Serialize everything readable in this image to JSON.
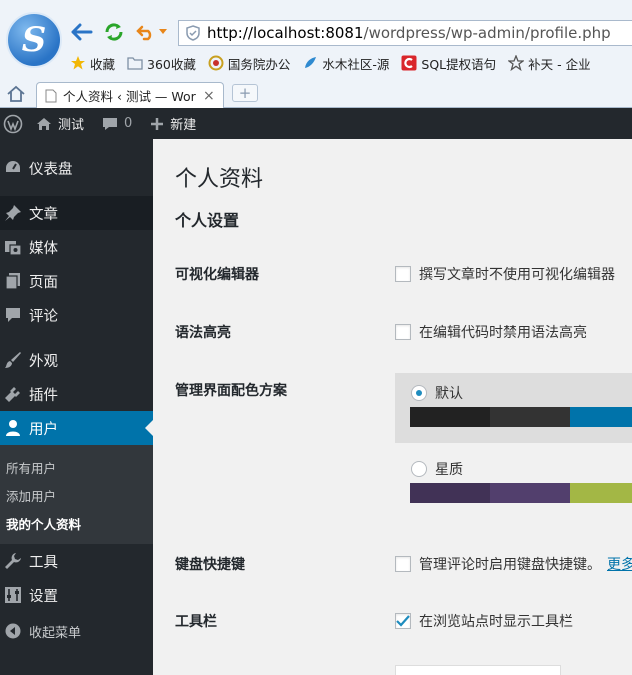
{
  "browser": {
    "url_host": "http://localhost:8081",
    "url_path": "/wordpress/wp-admin/profile.php",
    "bookmarks": [
      {
        "label": "收藏",
        "icon": "star-icon",
        "color": "#f2b705"
      },
      {
        "label": "360收藏",
        "icon": "folder-icon",
        "color": "#7d8fa3"
      },
      {
        "label": "国务院办公",
        "icon": "gov-icon",
        "color": "#c8a020"
      },
      {
        "label": "水木社区-源",
        "icon": "leaf-icon",
        "color": "#2f8ad0"
      },
      {
        "label": "SQL提权语句",
        "icon": "c-icon",
        "color": "#d9262b"
      },
      {
        "label": "补天 - 企业",
        "icon": "butian-icon",
        "color": "#555555"
      }
    ],
    "tab": {
      "label": "个人资料 ‹ 测试 — Wor",
      "close": "×"
    },
    "new_tab": "+"
  },
  "adminbar": {
    "site_name": "测试",
    "comments_count": "0",
    "new_label": "新建"
  },
  "sidebar": {
    "items": [
      {
        "label": "仪表盘",
        "icon": "dashboard-icon"
      },
      {
        "label": "文章",
        "icon": "pushpin-icon"
      },
      {
        "label": "媒体",
        "icon": "media-icon"
      },
      {
        "label": "页面",
        "icon": "page-icon"
      },
      {
        "label": "评论",
        "icon": "comment-icon"
      },
      {
        "label": "外观",
        "icon": "brush-icon"
      },
      {
        "label": "插件",
        "icon": "plugin-icon"
      },
      {
        "label": "用户",
        "icon": "user-icon"
      },
      {
        "label": "工具",
        "icon": "wrench-icon"
      },
      {
        "label": "设置",
        "icon": "settings-icon"
      }
    ],
    "submenu": [
      "所有用户",
      "添加用户",
      "我的个人资料"
    ],
    "collapse_label": "收起菜单"
  },
  "main": {
    "page_title": "个人资料",
    "section_title": "个人设置",
    "visual_editor": {
      "label": "可视化编辑器",
      "option": "撰写文章时不使用可视化编辑器",
      "checked": false
    },
    "syntax": {
      "label": "语法高亮",
      "option": "在编辑代码时禁用语法高亮",
      "checked": false
    },
    "color_scheme": {
      "label": "管理界面配色方案",
      "schemes": [
        {
          "name": "默认",
          "selected": true,
          "colors": [
            "#222222",
            "#333333",
            "#0073aa",
            "#00a0d2"
          ]
        },
        {
          "name": "星质",
          "selected": false,
          "colors": [
            "#413256",
            "#523f6d",
            "#a3b745",
            "#d46f15"
          ]
        }
      ]
    },
    "keyboard": {
      "label": "键盘快捷键",
      "option": "管理评论时启用键盘快捷键。",
      "link": "更多",
      "checked": false
    },
    "toolbar": {
      "label": "工具栏",
      "option": "在浏览站点时显示工具栏",
      "checked": true
    }
  }
}
